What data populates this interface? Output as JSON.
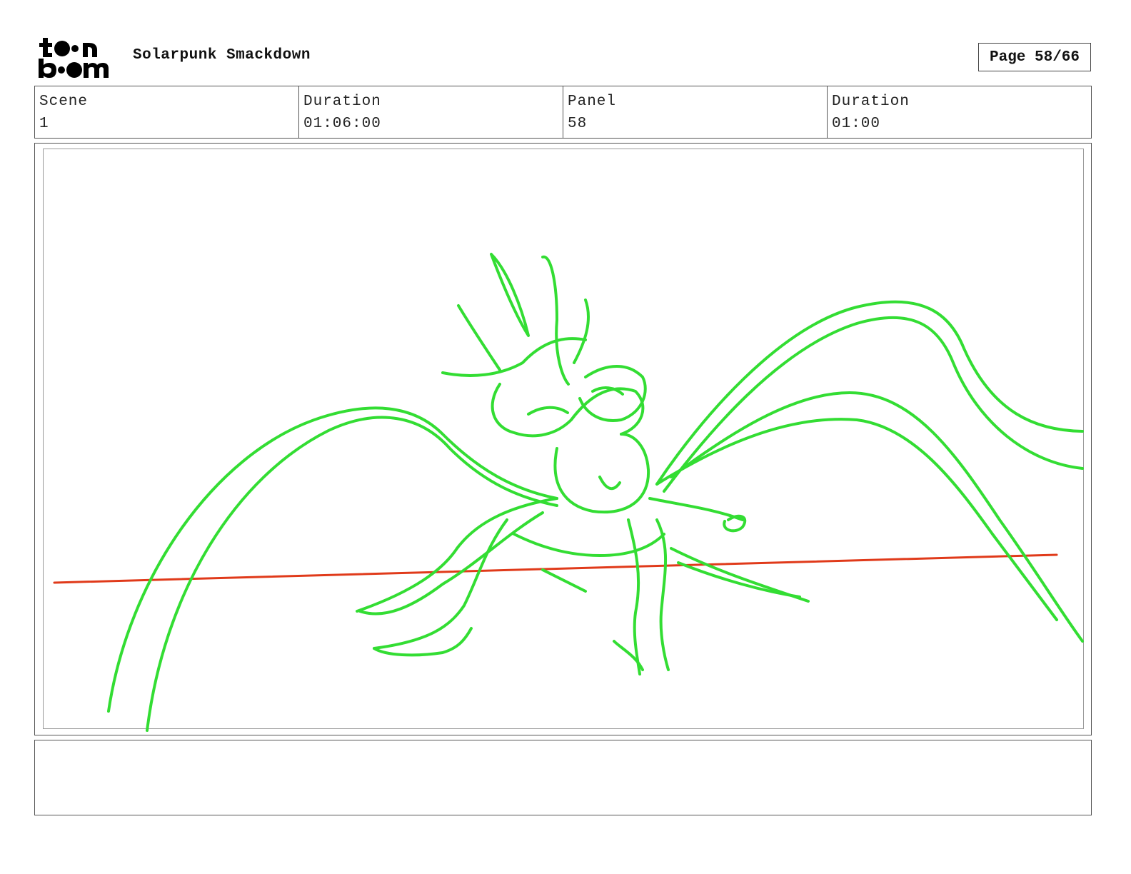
{
  "header": {
    "logo_text": "toon boom",
    "project_title": "Solarpunk Smackdown",
    "page_label": "Page 58/66"
  },
  "info": {
    "scene_label": "Scene",
    "scene_value": "1",
    "scene_duration_label": "Duration",
    "scene_duration_value": "01:06:00",
    "panel_label": "Panel",
    "panel_value": "58",
    "panel_duration_label": "Duration",
    "panel_duration_value": "01:00"
  },
  "panel": {
    "sketch_color": "#33dd33",
    "horizon_color": "#e03a1a",
    "description": "green rough sketch of a winged creature with outstretched wings, red horizon line"
  },
  "notes": {
    "text": ""
  }
}
